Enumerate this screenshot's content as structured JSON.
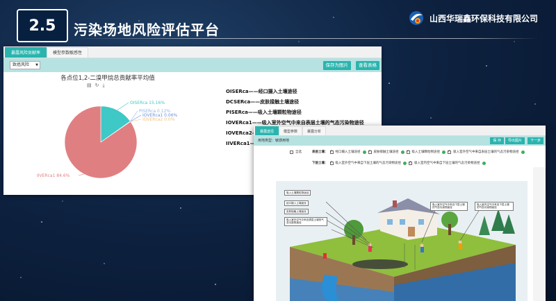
{
  "header": {
    "badge": "2.5",
    "title": "污染场地风险评估平台",
    "company": "山西华瑞鑫环保科技有限公司"
  },
  "panel1": {
    "tabs": [
      {
        "label": "暴露风险贡献率",
        "active": true
      },
      {
        "label": "模型参数敏感性",
        "active": false
      }
    ],
    "select_value": "致癌风险",
    "buttons": {
      "save_image": "保存为图片",
      "view_table": "查看表格"
    },
    "chart_title": "各点位1,2-二溴甲烷总贡献率平均值",
    "legend_lines": [
      "OISERca——经口摄入土壤途径",
      "DCSERca——皮肤接触土壤途径",
      "PISERca——吸入土壤颗粒物途径",
      "IOVERca1——吸入室外空气中来自表层土壤的气态污染物途径",
      "IOVERca2—",
      "IIVERca1—"
    ]
  },
  "chart_data": {
    "type": "pie",
    "title": "各点位1,2-二溴甲烷总贡献率平均值",
    "slices": [
      {
        "label": "OISERca",
        "value": 15.16,
        "text": "OISERca  15.16%",
        "color": "#3ec8c6"
      },
      {
        "label": "PISERca",
        "value": 0.12,
        "text": "PISERca  0.12%",
        "color": "#8fb6e6"
      },
      {
        "label": "IOVERca1",
        "value": 0.06,
        "text": "IOVERca1  0.06%",
        "color": "#6f8fd6"
      },
      {
        "label": "IOVERca2",
        "value": 0.0,
        "text": "IOVERca2  0.0%",
        "color": "#f1c27d"
      },
      {
        "label": "IIVERca1",
        "value": 84.6,
        "text": "IIVERca1  84.6%",
        "color": "#e07f82"
      }
    ]
  },
  "panel2": {
    "tabs": [
      {
        "label": "暴露途径",
        "active": true
      },
      {
        "label": "模型参数",
        "active": false
      },
      {
        "label": "暴露分析",
        "active": false
      }
    ],
    "site_type_label": "用地类型：敏感用地",
    "buttons": {
      "save": "保 存",
      "export_image": "导出图片",
      "next": "下一步"
    },
    "select_all": "全选",
    "surface_label": "表层土壤：",
    "surface_options": [
      "经口摄入土壤途径",
      "皮肤接触土壤途径",
      "吸入土壤颗粒物途径",
      "吸入室外空气中来自表层土壤的气态污染物途径"
    ],
    "subsurface_label": "下层土壤：",
    "subsurface_options": [
      "吸入室外空气中来自下层土壤的气态污染物途径",
      "吸入室内空气中来自下层土壤的气态污染物途径"
    ],
    "callouts": [
      "吸入土壤颗粒物途径",
      "经口摄入土壤途径",
      "皮肤接触土壤途径",
      "吸入室外空气中来自表层土壤的气态污染物途径",
      "吸入室外空气中来自下层土壤的气态污染物途径",
      "吸入室内空气中来自下层土壤的气态污染物途径"
    ]
  }
}
